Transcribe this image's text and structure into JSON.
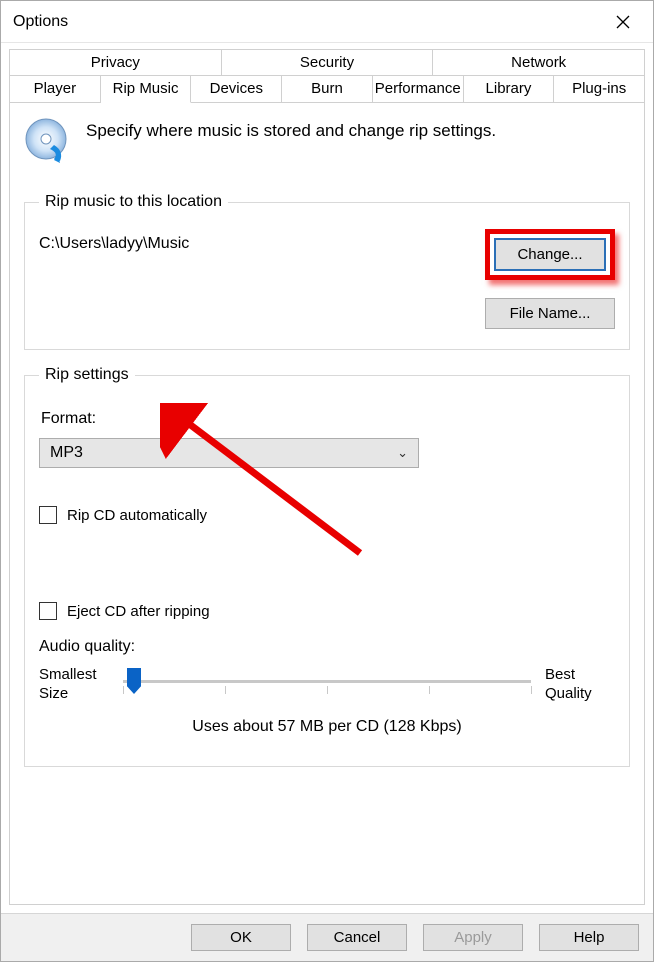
{
  "window": {
    "title": "Options"
  },
  "tabsTop": [
    {
      "label": "Privacy"
    },
    {
      "label": "Security"
    },
    {
      "label": "Network"
    }
  ],
  "tabsBottom": [
    {
      "label": "Player"
    },
    {
      "label": "Rip Music",
      "active": true
    },
    {
      "label": "Devices"
    },
    {
      "label": "Burn"
    },
    {
      "label": "Performance"
    },
    {
      "label": "Library"
    },
    {
      "label": "Plug-ins"
    }
  ],
  "intro": "Specify where music is stored and change rip settings.",
  "location": {
    "legend": "Rip music to this location",
    "path": "C:\\Users\\ladyy\\Music",
    "changeLabel": "Change...",
    "fileNameLabel": "File Name..."
  },
  "settings": {
    "legend": "Rip settings",
    "formatLabel": "Format:",
    "formatValue": "MP3",
    "ripAuto": "Rip CD automatically",
    "ejectAfter": "Eject CD after ripping",
    "audioQualityLabel": "Audio quality:",
    "smallest": "Smallest Size",
    "best": "Best Quality",
    "usage": "Uses about 57 MB per CD (128 Kbps)"
  },
  "footer": {
    "ok": "OK",
    "cancel": "Cancel",
    "apply": "Apply",
    "help": "Help"
  }
}
